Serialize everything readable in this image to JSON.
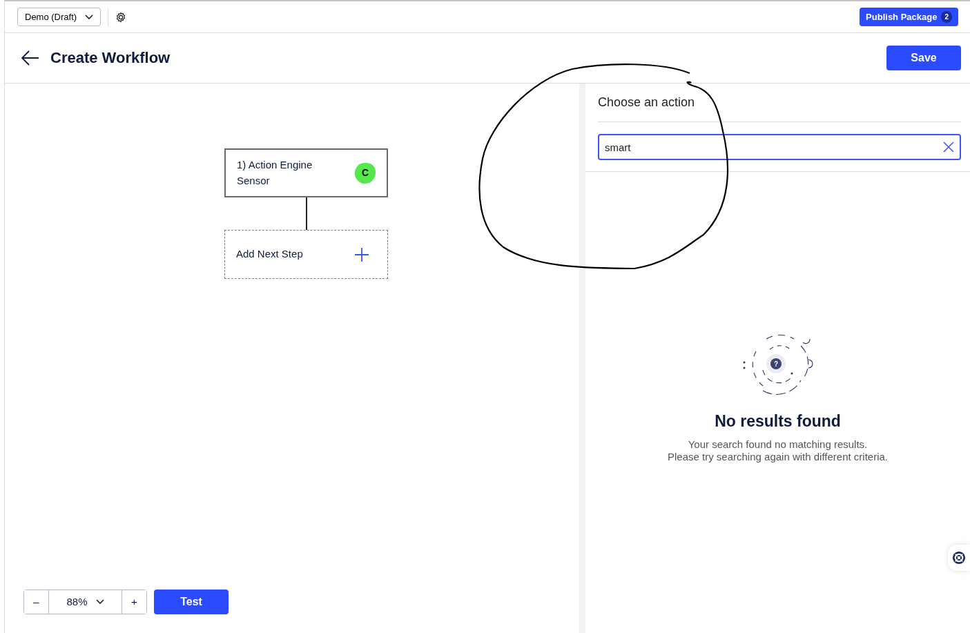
{
  "toolbar": {
    "environment": "Demo (Draft)",
    "publish_button": "Publish Package",
    "publish_count": "2"
  },
  "header": {
    "title": "Create Workflow",
    "save_button": "Save"
  },
  "canvas": {
    "steps": [
      {
        "label": "1) Action Engine Sensor",
        "badge": "C"
      }
    ],
    "add_step": "Add Next Step"
  },
  "zoom": {
    "minus": "–",
    "value": "88%",
    "plus": "+"
  },
  "test_button": "Test",
  "panel": {
    "title": "Choose an action",
    "search": {
      "value": "smart"
    },
    "empty": {
      "icon_glyph": "?",
      "title": "No results found",
      "lines": [
        "Your search found no matching results.",
        "Please try searching again with different criteria."
      ]
    }
  }
}
